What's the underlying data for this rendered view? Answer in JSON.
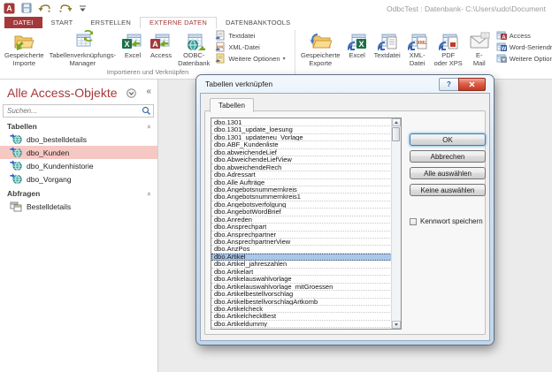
{
  "window": {
    "title": "OdbcTest : Datenbank- C:\\Users\\udo\\Document"
  },
  "qat": {
    "icons": [
      "access-app-icon",
      "save-icon",
      "undo-icon",
      "redo-icon",
      "qat-customize-icon"
    ]
  },
  "ribbon": {
    "tabs": [
      {
        "label": "DATEI",
        "type": "file"
      },
      {
        "label": "START",
        "type": "normal"
      },
      {
        "label": "ERSTELLEN",
        "type": "normal"
      },
      {
        "label": "EXTERNE DATEN",
        "type": "active"
      },
      {
        "label": "DATENBANKTOOLS",
        "type": "normal"
      }
    ],
    "import_group": {
      "label": "Importieren und Verknüpfen",
      "big_buttons": [
        {
          "lines": [
            "Gespeicherte",
            "Importe"
          ],
          "icon": "saved-imports-icon"
        },
        {
          "lines": [
            "Tabellenverknüpfungs-",
            "Manager"
          ],
          "icon": "linked-table-manager-icon"
        },
        {
          "lines": [
            "Excel"
          ],
          "icon": "excel-import-icon"
        },
        {
          "lines": [
            "Access"
          ],
          "icon": "access-import-icon"
        },
        {
          "lines": [
            "ODBC-",
            "Datenbank"
          ],
          "icon": "odbc-database-icon"
        }
      ],
      "small_buttons": [
        {
          "label": "Textdatei",
          "icon": "text-file-icon",
          "dropdown": false
        },
        {
          "label": "XML-Datei",
          "icon": "xml-file-icon",
          "dropdown": false
        },
        {
          "label": "Weitere Optionen",
          "icon": "more-options-icon",
          "dropdown": true
        }
      ]
    },
    "export_group": {
      "big_buttons": [
        {
          "lines": [
            "Gespeicherte",
            "Exporte"
          ],
          "icon": "saved-exports-icon"
        },
        {
          "lines": [
            "Excel"
          ],
          "icon": "excel-export-icon"
        },
        {
          "lines": [
            "Textdatei"
          ],
          "icon": "text-export-icon"
        },
        {
          "lines": [
            "XML-",
            "Datei"
          ],
          "icon": "xml-export-icon"
        },
        {
          "lines": [
            "PDF",
            "oder XPS"
          ],
          "icon": "pdf-xps-icon"
        },
        {
          "lines": [
            "E-",
            "Mail"
          ],
          "icon": "email-icon"
        }
      ],
      "small_buttons": [
        {
          "label": "Access",
          "icon": "access-export-icon",
          "dropdown": false
        },
        {
          "label": "Word-Seriendruck",
          "icon": "word-merge-icon",
          "dropdown": false
        },
        {
          "label": "Weitere Optionen",
          "icon": "more-options-export-icon",
          "dropdown": true
        }
      ]
    }
  },
  "sidebar": {
    "title": "Alle Access-Objekte",
    "search_placeholder": "Suchen...",
    "sections": [
      {
        "label": "Tabellen",
        "items": [
          {
            "label": "dbo_bestelldetails",
            "icon": "linked-table-icon",
            "selected": false
          },
          {
            "label": "dbo_Kunden",
            "icon": "linked-table-icon",
            "selected": true
          },
          {
            "label": "dbo_Kundenhistorie",
            "icon": "linked-table-icon",
            "selected": false
          },
          {
            "label": "dbo_Vorgang",
            "icon": "linked-table-icon",
            "selected": false
          }
        ]
      },
      {
        "label": "Abfragen",
        "items": [
          {
            "label": "Bestelldetails",
            "icon": "query-icon",
            "selected": false
          }
        ]
      }
    ]
  },
  "dialog": {
    "title": "Tabellen verknüpfen",
    "tab_label": "Tabellen",
    "tables": [
      "dbo.1301",
      "dbo.1301_update_loesung",
      "dbo.1301_updateneu_Vorlage",
      "dbo.ABF_Kundenliste",
      "dbo.abweichendeLief",
      "dbo.AbweichendeLiefView",
      "dbo.abweichendeRech",
      "dbo.Adressart",
      "dbo.Alle Aufträge",
      "dbo.Angebotsnummernkreis",
      "dbo.Angebotsnummernkreis1",
      "dbo.Angebotsverfolgung",
      "dbo.AngebotWordBrief",
      "dbo.Anreden",
      "dbo.Ansprechpart",
      "dbo.Ansprechpartner",
      "dbo.AnsprechpartnerView",
      "dbo.AnzPos",
      "dbo.Artikel",
      "dbo.Artikel_jahreszahlen",
      "dbo.Artikelart",
      "dbo.Artikelauswahlvorlage",
      "dbo.Artikelauswahlvorlage_mitGroessen",
      "dbo.Artikelbestellvorschlag",
      "dbo.ArtikelbestellvorschlagArtkomb",
      "dbo.Artikelcheck",
      "dbo.ArtikelcheckBest",
      "dbo.Artikeldummy"
    ],
    "selected_table": "dbo.Artikel",
    "selected_index": 18,
    "buttons": [
      {
        "label": "OK",
        "default": true
      },
      {
        "label": "Abbrechen",
        "default": false
      },
      {
        "label": "Alle auswählen",
        "default": false
      },
      {
        "label": "Keine auswählen",
        "default": false
      }
    ],
    "checkbox": {
      "label": "Kennwort speichern",
      "checked": false
    }
  },
  "colors": {
    "accent": "#a5383a",
    "sidebar_selection": "#f6c8c4",
    "list_selection": "#a8c8ea",
    "ribbon_bg": "#ffffff",
    "main_bg": "#ebebeb"
  }
}
